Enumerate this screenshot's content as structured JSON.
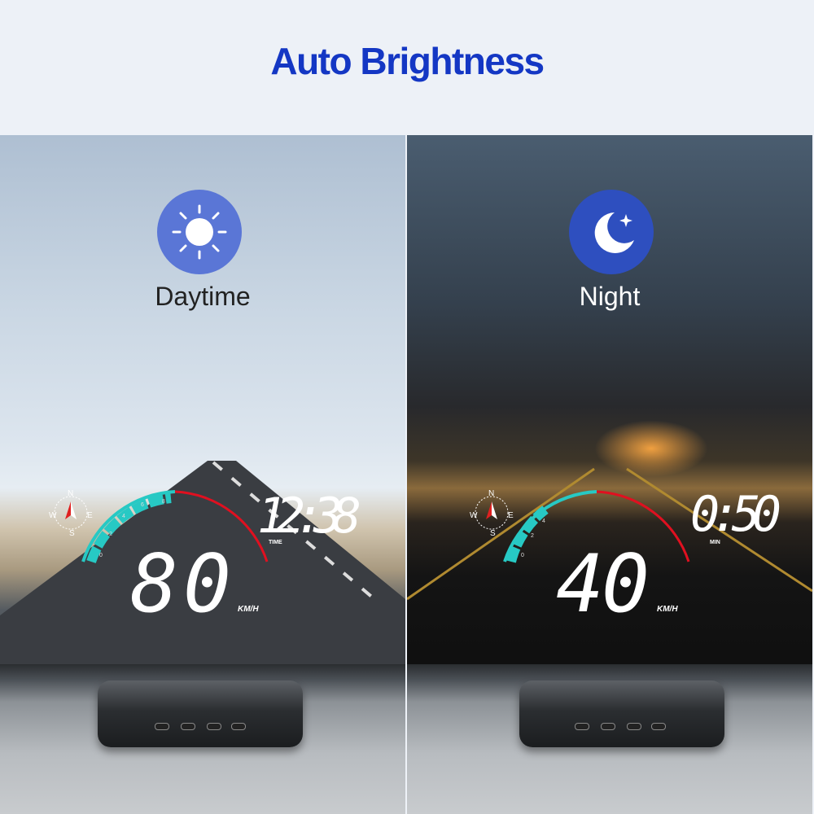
{
  "header": {
    "title": "Auto Brightness"
  },
  "panels": [
    {
      "mode": "Daytime",
      "icon": "sun-icon",
      "time": "12:38",
      "time_label": "TIME",
      "speed": "80",
      "unit": "KM/H",
      "scale": [
        "0",
        "2",
        "4",
        "6",
        "8"
      ],
      "compass": [
        "N",
        "E",
        "S",
        "W"
      ]
    },
    {
      "mode": "Night",
      "icon": "moon-icon",
      "time": "0:50",
      "time_label": "MIN",
      "speed": "40",
      "unit": "KM/H",
      "scale": [
        "0",
        "2",
        "4"
      ],
      "compass": [
        "N",
        "E",
        "S",
        "W"
      ]
    }
  ],
  "colors": {
    "title": "#1437c4",
    "gauge": "#27c9c4",
    "redline": "#e01020"
  }
}
